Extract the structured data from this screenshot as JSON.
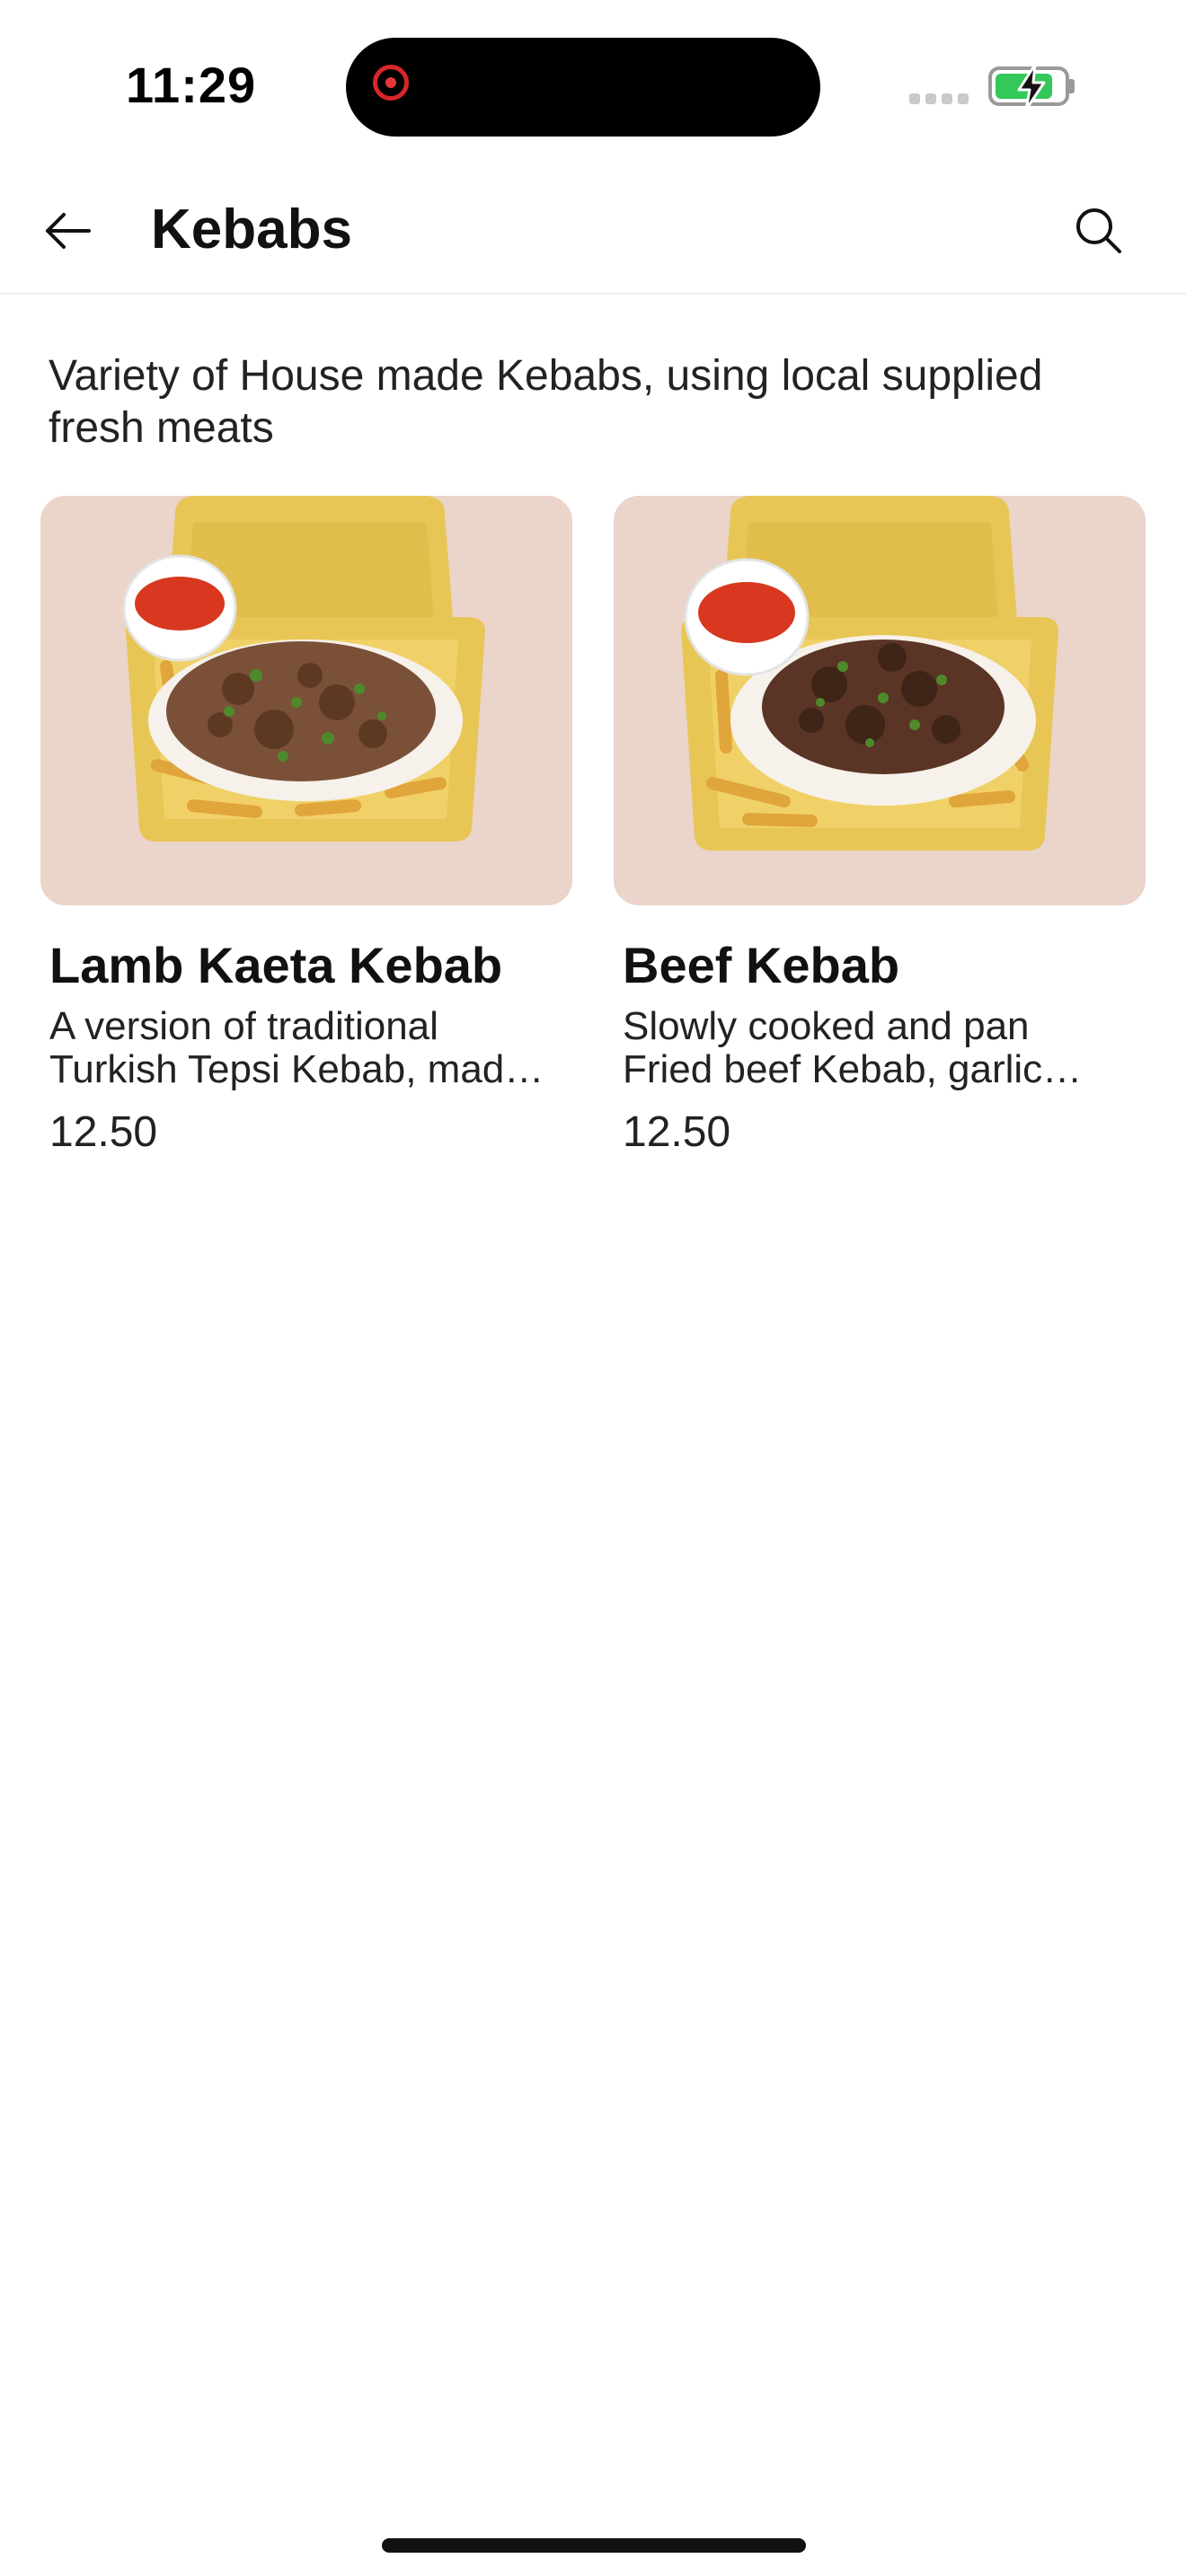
{
  "status_bar": {
    "time": "11:29",
    "battery_level": 0.85
  },
  "header": {
    "title": "Kebabs",
    "back_icon": "arrow-left-icon",
    "search_icon": "search-icon"
  },
  "category": {
    "description": "Variety of House made Kebabs, using local supplied fresh meats"
  },
  "items": [
    {
      "name": "Lamb Kaeta Kebab",
      "description": "A version of traditional Turkish Tepsi Kebab, mad…",
      "price": "12.50"
    },
    {
      "name": "Beef Kebab",
      "description": "Slowly cooked and pan Fried beef Kebab, garlic…",
      "price": "12.50"
    }
  ],
  "colors": {
    "recording": "#d7262a",
    "battery": "#34c759",
    "container": "#e8c655",
    "tablecloth": "#efd9cf"
  }
}
